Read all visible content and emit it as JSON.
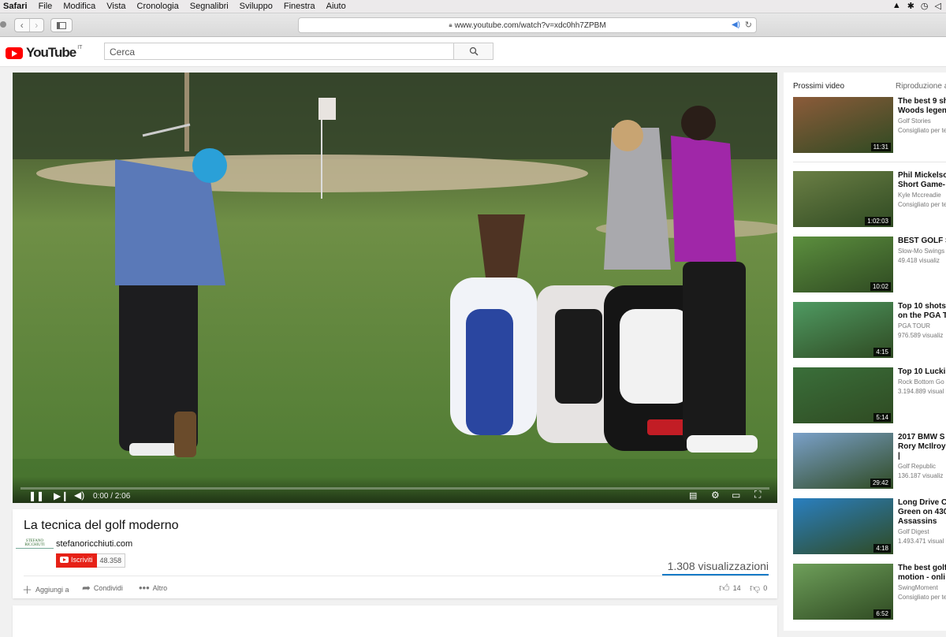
{
  "menubar": {
    "items": [
      "Safari",
      "File",
      "Modifica",
      "Vista",
      "Cronologia",
      "Segnalibri",
      "Sviluppo",
      "Finestra",
      "Aiuto"
    ],
    "right_icons": [
      "adobe-icon",
      "bluetooth-icon",
      "time-machine-icon",
      "volume-icon"
    ]
  },
  "browser": {
    "url": "www.youtube.com/watch?v=xdc0hh7ZPBM"
  },
  "youtube": {
    "logo_text": "YouTube",
    "country": "IT",
    "search_placeholder": "Cerca"
  },
  "player": {
    "time": "0:00 / 2:06",
    "progress": 0.0
  },
  "video": {
    "title": "La tecnica del golf moderno",
    "channel": "stefanoricchiuti.com",
    "channel_logo_text": "STEFANO RICCHIUTI",
    "subscribe_label": "Iscriviti",
    "subscribers": "48.358",
    "views": "1.308 visualizzazioni",
    "actions": {
      "add_to": "Aggiungi a",
      "share": "Condividi",
      "more": "Altro",
      "likes": "14",
      "dislikes": "0"
    }
  },
  "sidebar": {
    "header": "Prossimi video",
    "autoplay": "Riproduzione a",
    "items": [
      {
        "title1": "The best 9 sh",
        "title2": "Woods legen",
        "channel": "Golf Stories",
        "meta": "Consigliato per te",
        "duration": "11:31",
        "color": "#8c5b3a"
      },
      {
        "title1": "Phil Mickelso",
        "title2": "Short Game-",
        "channel": "Kyle Mccreadie",
        "meta": "Consigliato per te",
        "duration": "1:02:03",
        "color": "#6b7f45"
      },
      {
        "title1": "BEST GOLF S",
        "title2": "",
        "channel": "Slow-Mo Swings",
        "meta": "49.418 visualiz",
        "duration": "10:02",
        "color": "#5c8f3e"
      },
      {
        "title1": "Top 10 shots",
        "title2": "on the PGA T",
        "channel": "PGA TOUR",
        "meta": "976.589 visualiz",
        "duration": "4:15",
        "color": "#4f9a62"
      },
      {
        "title1": "Top 10 Lucki",
        "title2": "",
        "channel": "Rock Bottom Go",
        "meta": "3.194.889 visual",
        "duration": "5:14",
        "color": "#3a6f3a"
      },
      {
        "title1": "2017 BMW S",
        "title2": "Rory McIlroy",
        "title3": "|",
        "channel": "Golf Republic",
        "meta": "136.187 visualiz",
        "duration": "29:42",
        "color": "#7aa0c9"
      },
      {
        "title1": "Long Drive C",
        "title2": "Green on 430",
        "title3": "Assassins",
        "channel": "Golf Digest",
        "meta": "1.493.471 visual",
        "duration": "4:18",
        "color": "#2a7fc0"
      },
      {
        "title1": "The best golf",
        "title2": "motion - onli",
        "channel": "SwingMoment",
        "meta": "Consigliato per te",
        "duration": "6:52",
        "color": "#6e9f5a"
      }
    ]
  }
}
